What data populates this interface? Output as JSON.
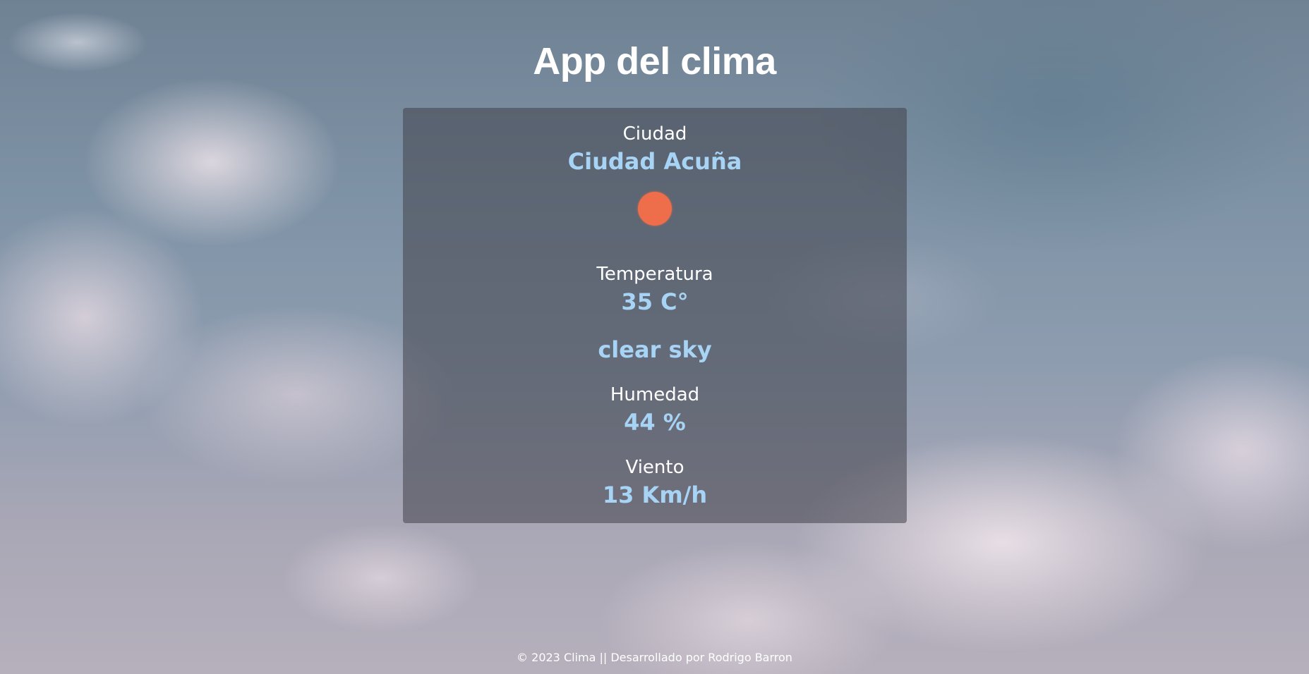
{
  "header": {
    "title": "App del clima"
  },
  "weather": {
    "city_label": "Ciudad",
    "city_value": "Ciudad Acuña",
    "icon": "sun-icon",
    "icon_color": "#ee6d4a",
    "temperature_label": "Temperatura",
    "temperature_value": "35 C°",
    "description": "clear sky",
    "humidity_label": "Humedad",
    "humidity_value": "44 %",
    "wind_label": "Viento",
    "wind_value": "13 Km/h"
  },
  "footer": {
    "text": "© 2023 Clima || Desarrollado por Rodrigo Barron"
  },
  "colors": {
    "value_accent": "#a7d3f5",
    "card_background": "rgba(66, 66, 74, 0.55)"
  }
}
